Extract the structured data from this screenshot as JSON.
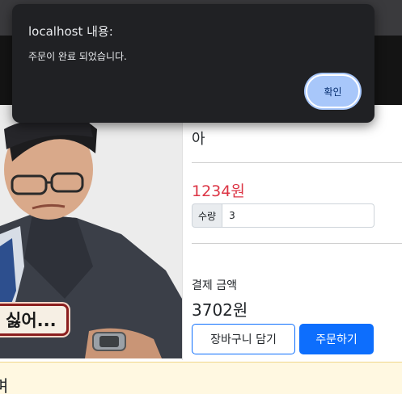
{
  "dialog": {
    "title": "localhost 내용:",
    "message": "주문이 완료 되었습니다.",
    "ok_label": "확인"
  },
  "product": {
    "name": "아",
    "price": "1234원",
    "image_caption": "싫어..."
  },
  "quantity": {
    "label": "수량",
    "value": "3"
  },
  "total": {
    "label": "결제 금액",
    "value": "3702원"
  },
  "actions": {
    "cart_label": "장바구니 담기",
    "order_label": "주문하기"
  },
  "footer": {
    "partial_text": "며"
  },
  "colors": {
    "price": "#dc3545",
    "primary": "#0d6efd",
    "dialog_bg": "#202124",
    "dialog_button": "#a8c7fa"
  }
}
